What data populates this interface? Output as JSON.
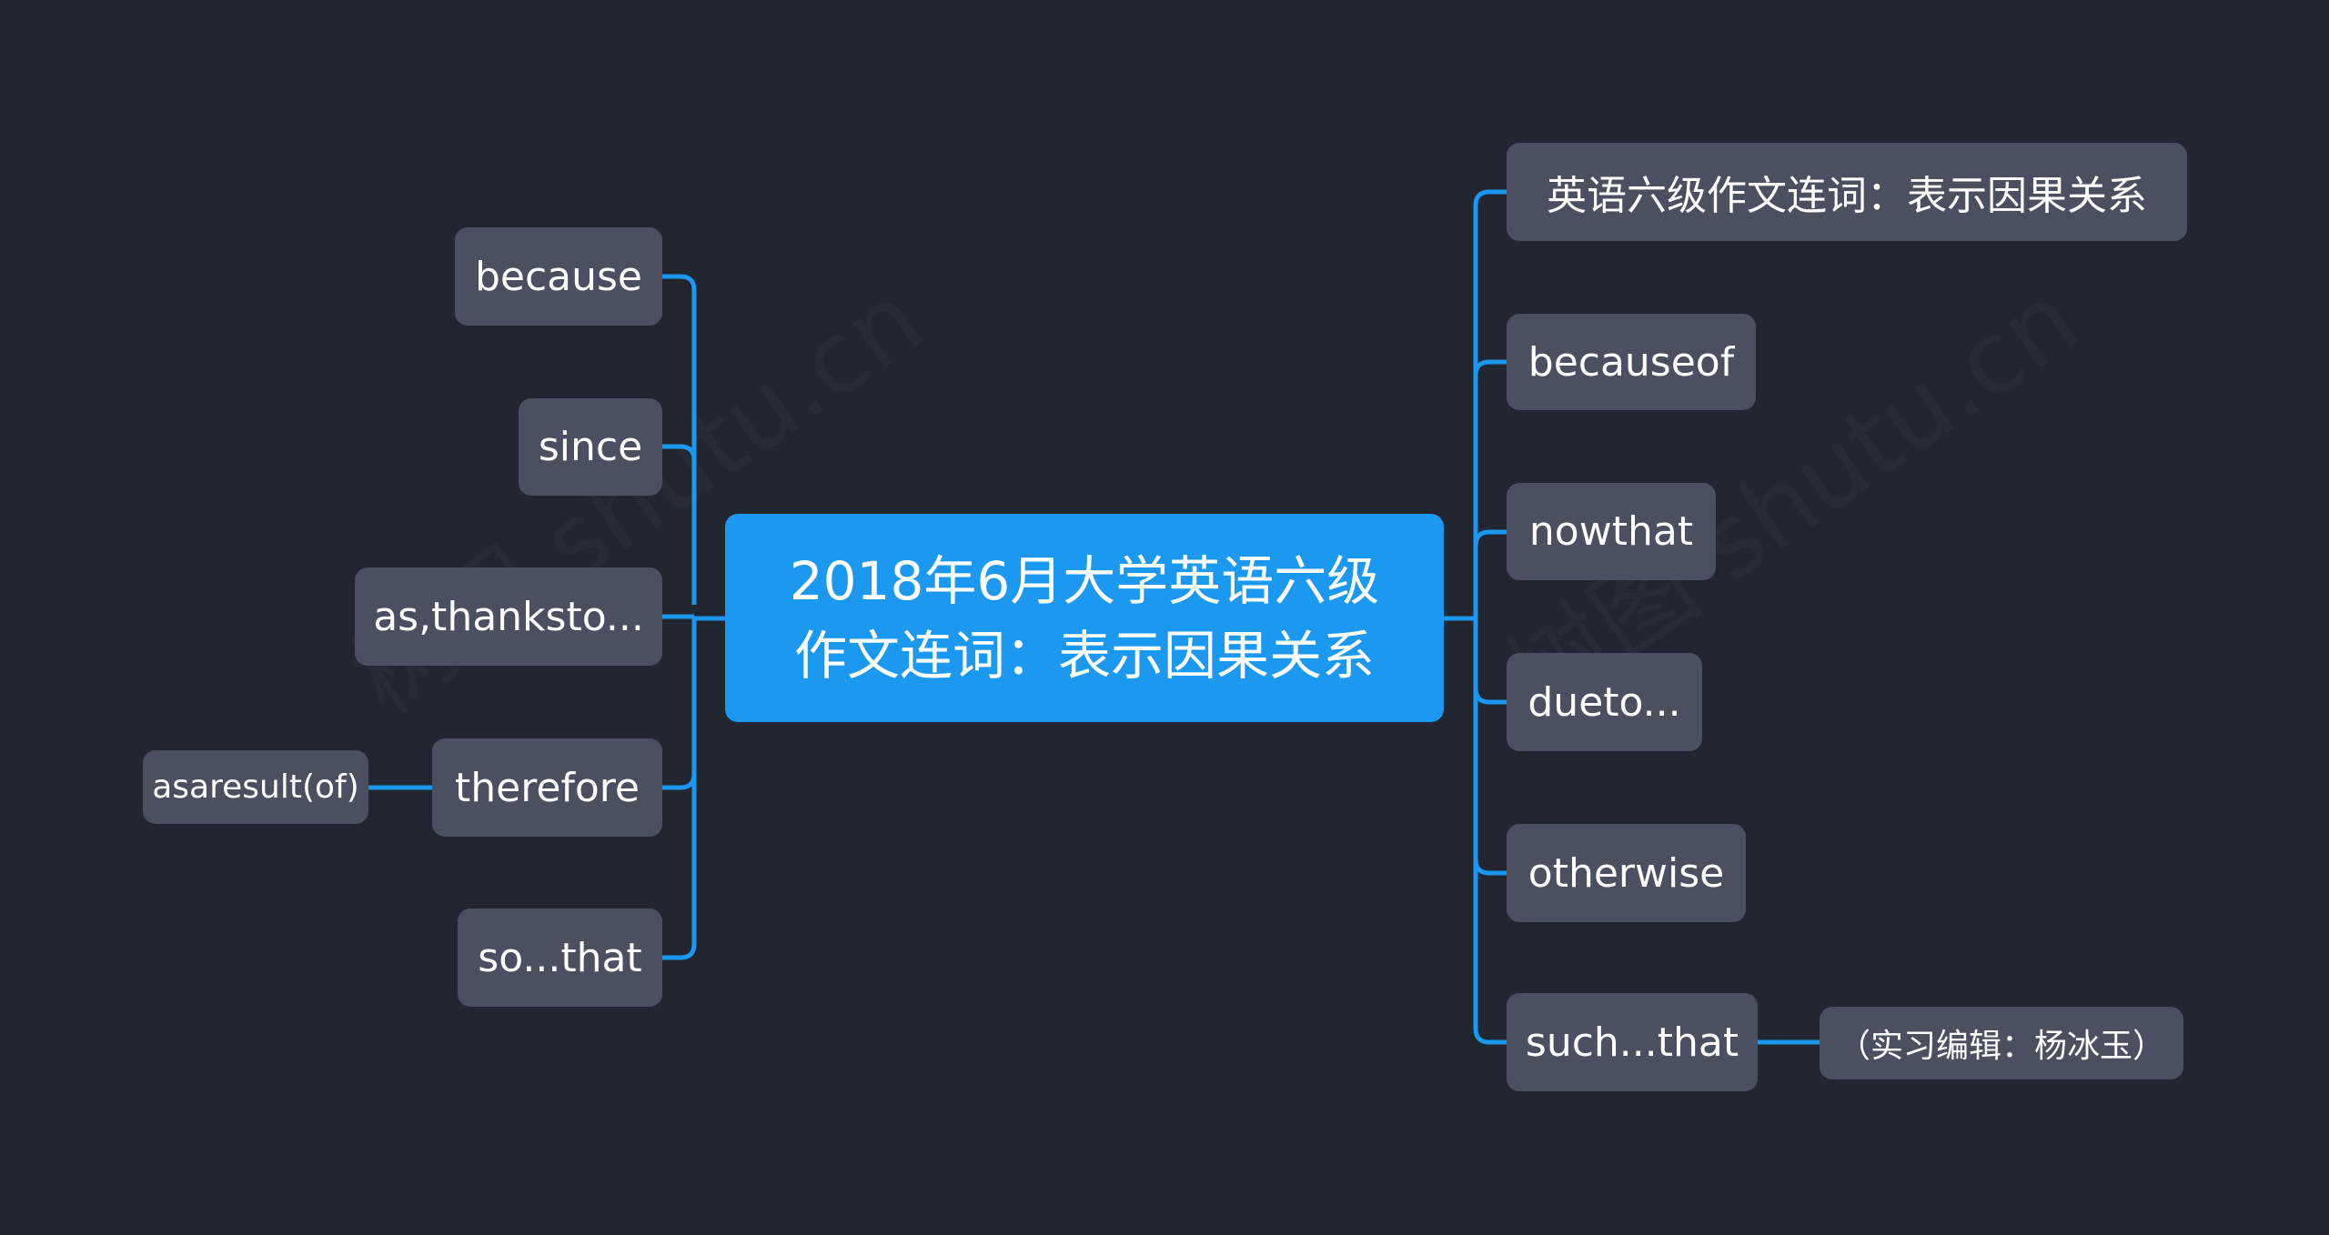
{
  "root": {
    "line1": "2018年6月大学英语六级",
    "line2": "作文连词：表示因果关系"
  },
  "left": [
    {
      "label": "because"
    },
    {
      "label": "since"
    },
    {
      "label": "as,thanksto..."
    },
    {
      "label": "therefore",
      "child": "asaresult(of)"
    },
    {
      "label": "so...that"
    }
  ],
  "right": [
    {
      "label": "英语六级作文连词：表示因果关系"
    },
    {
      "label": "becauseof"
    },
    {
      "label": "nowthat"
    },
    {
      "label": "dueto..."
    },
    {
      "label": "otherwise"
    },
    {
      "label": "such...that",
      "child": "（实习编辑：杨冰玉）"
    }
  ],
  "watermark": "树图 shutu.cn",
  "colors": {
    "background": "#222631",
    "root": "#1b98ef",
    "node": "#4a5060",
    "link": "#1b98ef"
  }
}
